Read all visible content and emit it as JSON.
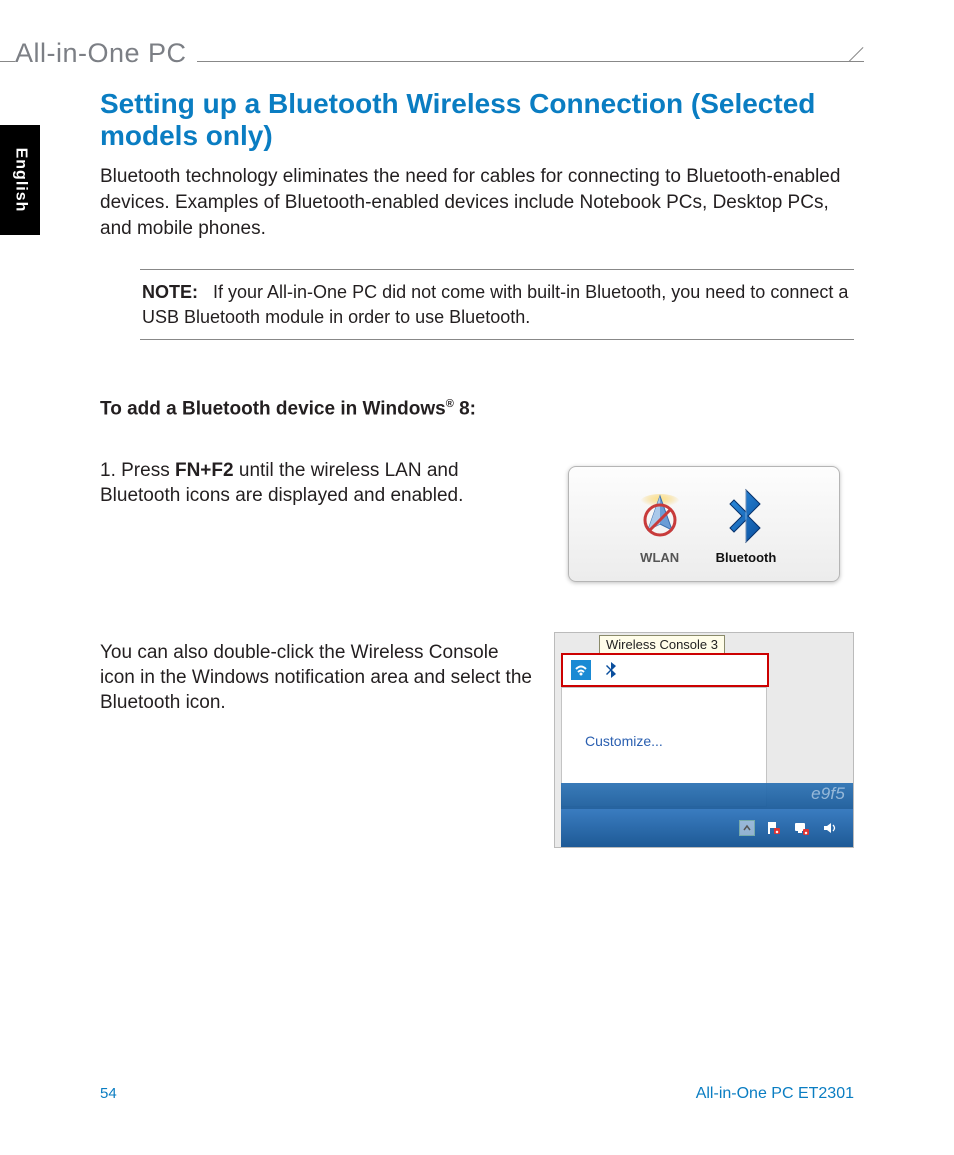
{
  "header": {
    "brand": "All-in-One PC"
  },
  "sidetab": {
    "label": "English"
  },
  "title": "Setting up a Bluetooth Wireless Connection (Selected models only)",
  "intro": "Bluetooth technology eliminates the need for cables for connecting to Bluetooth-enabled devices. Examples of Bluetooth-enabled devices include Notebook PCs, Desktop PCs, and mobile phones.",
  "note": {
    "label": "NOTE:",
    "text": "If your All-in-One PC did not come with built-in Bluetooth, you need to connect a USB Bluetooth module in order to use Bluetooth."
  },
  "subhead_prefix": "To add a Bluetooth device in Windows",
  "subhead_suffix": " 8:",
  "step1": {
    "num": "1. ",
    "pre": "Press ",
    "key": "FN+F2",
    "post": " until the wireless LAN and Bluetooth icons are displayed and enabled."
  },
  "fig1": {
    "wlan_label": "WLAN",
    "bt_label": "Bluetooth"
  },
  "step2": {
    "text": " You can also double-click the Wireless Console icon in the Windows notification area and select the Bluetooth icon."
  },
  "fig2": {
    "tooltip": "Wireless Console 3",
    "customize": "Customize...",
    "titlebar_fragment": "e9f5"
  },
  "footer": {
    "page": "54",
    "model": "All-in-One PC ET2301"
  }
}
